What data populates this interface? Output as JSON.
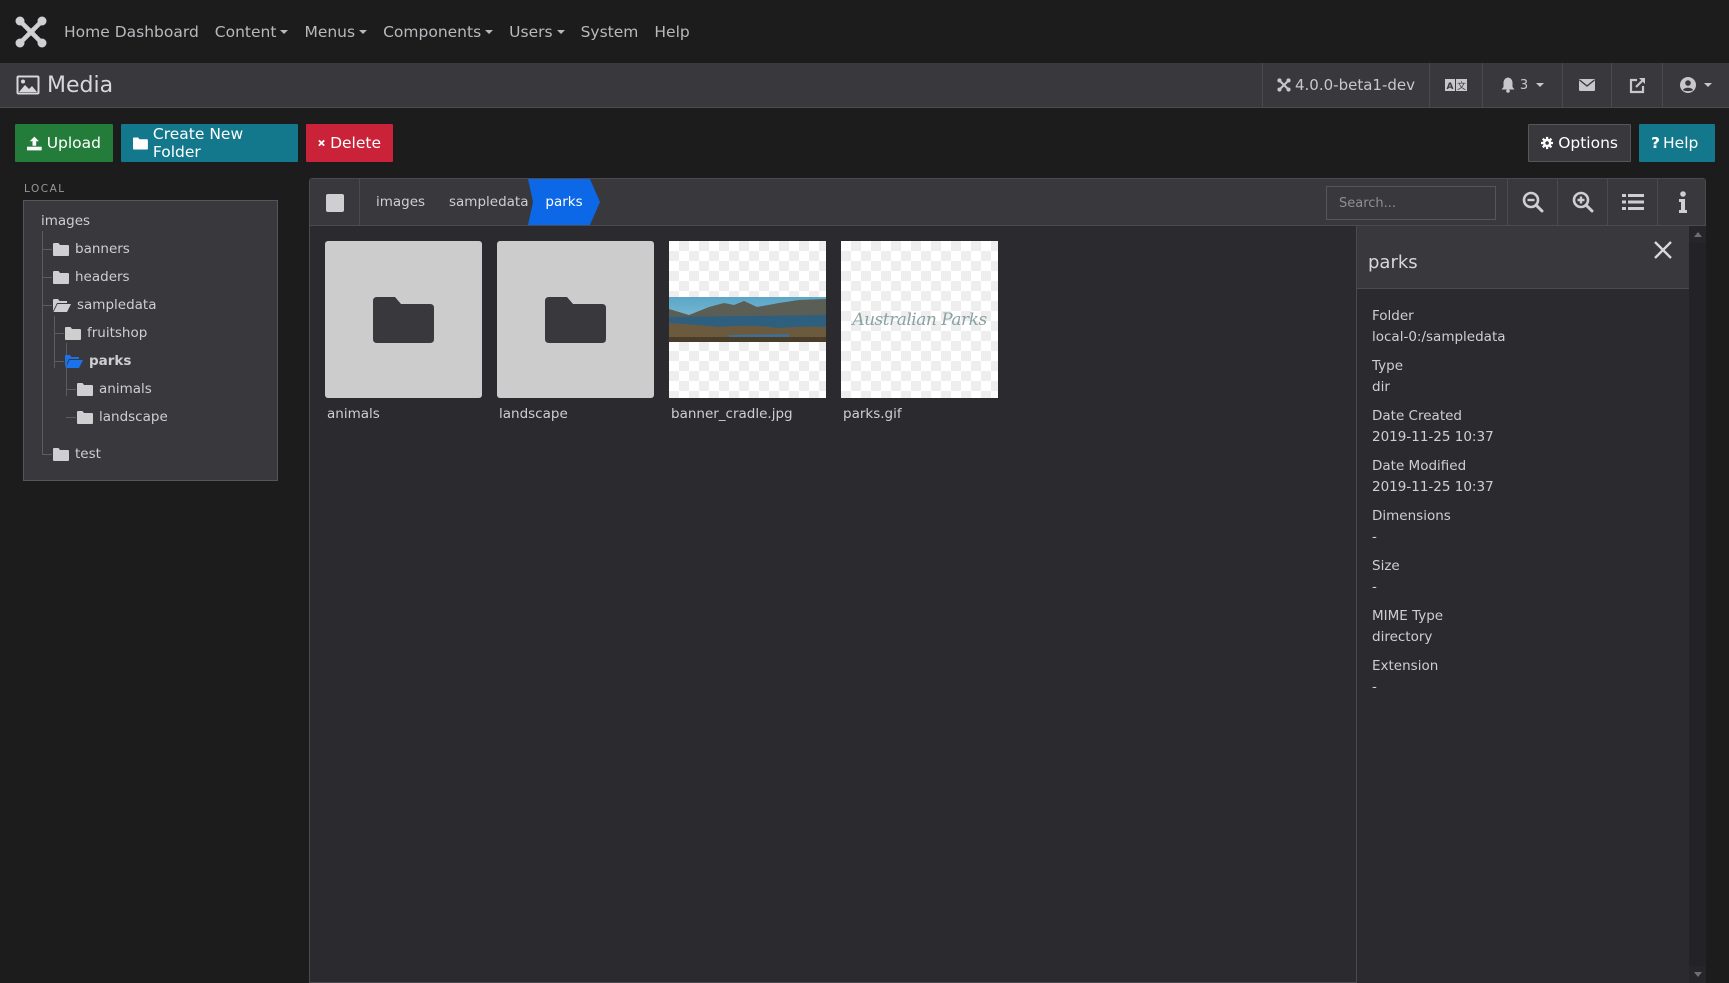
{
  "nav": {
    "items": [
      {
        "label": "Home Dashboard",
        "dropdown": false
      },
      {
        "label": "Content",
        "dropdown": true
      },
      {
        "label": "Menus",
        "dropdown": true
      },
      {
        "label": "Components",
        "dropdown": true
      },
      {
        "label": "Users",
        "dropdown": true
      },
      {
        "label": "System",
        "dropdown": false
      },
      {
        "label": "Help",
        "dropdown": false
      }
    ]
  },
  "header": {
    "title": "Media",
    "version": "4.0.0-beta1-dev",
    "notifications_count": "3"
  },
  "toolbar": {
    "upload_label": "Upload",
    "create_folder_label": "Create New Folder",
    "delete_label": "Delete",
    "options_label": "Options",
    "help_label": "Help"
  },
  "sidebar": {
    "section_label": "LOCAL",
    "root": "images",
    "items": [
      {
        "label": "banners",
        "level": 1,
        "state": "closed"
      },
      {
        "label": "headers",
        "level": 1,
        "state": "closed"
      },
      {
        "label": "sampledata",
        "level": 1,
        "state": "open"
      },
      {
        "label": "fruitshop",
        "level": 2,
        "state": "closed"
      },
      {
        "label": "parks",
        "level": 2,
        "state": "active"
      },
      {
        "label": "animals",
        "level": 3,
        "state": "closed"
      },
      {
        "label": "landscape",
        "level": 3,
        "state": "closed"
      },
      {
        "label": "test",
        "level": 1,
        "state": "closed"
      }
    ]
  },
  "browser": {
    "breadcrumbs": [
      "images",
      "sampledata",
      "parks"
    ],
    "search_placeholder": "Search...",
    "items": [
      {
        "name": "animals",
        "type": "folder"
      },
      {
        "name": "landscape",
        "type": "folder"
      },
      {
        "name": "banner_cradle.jpg",
        "type": "image"
      },
      {
        "name": "parks.gif",
        "type": "image"
      }
    ],
    "parks_gif_text": "Australian Parks"
  },
  "info": {
    "title": "parks",
    "fields": [
      {
        "key": "Folder",
        "value": "local-0:/sampledata"
      },
      {
        "key": "Type",
        "value": "dir"
      },
      {
        "key": "Date Created",
        "value": "2019-11-25 10:37"
      },
      {
        "key": "Date Modified",
        "value": "2019-11-25 10:37"
      },
      {
        "key": "Dimensions",
        "value": "-"
      },
      {
        "key": "Size",
        "value": "-"
      },
      {
        "key": "MIME Type",
        "value": "directory"
      },
      {
        "key": "Extension",
        "value": "-"
      }
    ]
  },
  "colors": {
    "accent_blue": "#0c68e6",
    "upload_green": "#237c3a",
    "teal": "#13788c",
    "delete_red": "#ca2339"
  }
}
